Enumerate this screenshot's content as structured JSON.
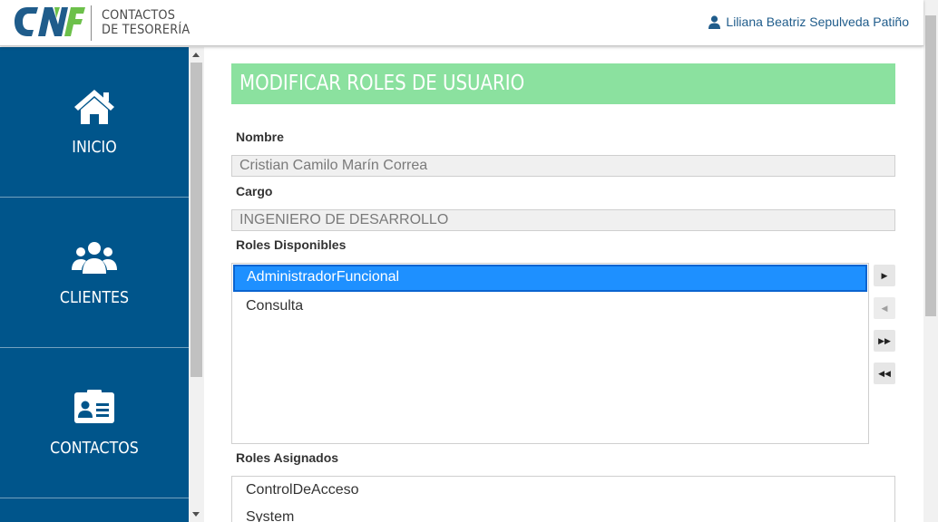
{
  "header": {
    "app_title_line1": "CONTACTOS",
    "app_title_line2": "DE TESORERÍA",
    "user_name": "Liliana Beatriz Sepulveda Patiño",
    "colors": {
      "brand_blue": "#1f5c8b",
      "brand_green": "#6cc04a"
    }
  },
  "sidebar": {
    "items": [
      {
        "label": "INICIO",
        "icon": "home-icon"
      },
      {
        "label": "CLIENTES",
        "icon": "users-icon"
      },
      {
        "label": "CONTACTOS",
        "icon": "contact-card-icon"
      }
    ],
    "color": "#00558b"
  },
  "page": {
    "title": "MODIFICAR ROLES DE USUARIO",
    "title_bg": "#8be19f",
    "nombre_label": "Nombre",
    "nombre_value": "Cristian Camilo Marín Correa",
    "cargo_label": "Cargo",
    "cargo_value": "INGENIERO DE DESARROLLO",
    "disponibles_label": "Roles Disponibles",
    "disponibles": [
      {
        "label": "AdministradorFuncional",
        "selected": true
      },
      {
        "label": "Consulta",
        "selected": false
      }
    ],
    "asignados_label": "Roles Asignados",
    "asignados": [
      {
        "label": "ControlDeAcceso"
      },
      {
        "label": "System"
      }
    ],
    "move_buttons": [
      {
        "glyph": "▶",
        "name": "move-right-button",
        "enabled": true
      },
      {
        "glyph": "◀",
        "name": "move-left-button",
        "enabled": false
      },
      {
        "glyph": "▶▶",
        "name": "move-all-right-button",
        "enabled": true
      },
      {
        "glyph": "◀◀",
        "name": "move-all-left-button",
        "enabled": true
      }
    ]
  }
}
